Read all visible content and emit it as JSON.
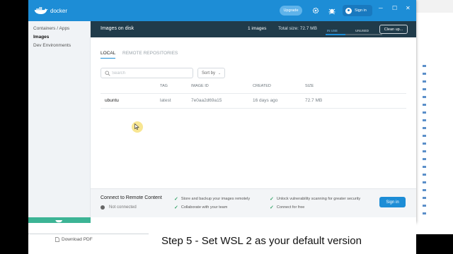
{
  "app": {
    "name": "docker",
    "upgrade_label": "Upgrade",
    "signin_label": "Sign in",
    "accent": "#1d8dd6"
  },
  "sidebar": {
    "items": [
      {
        "label": "Containers / Apps",
        "active": false
      },
      {
        "label": "Images",
        "active": true
      },
      {
        "label": "Dev Environments",
        "active": false
      }
    ]
  },
  "header": {
    "title": "Images on disk",
    "count": "1 images",
    "total_size": "Total size: 72.7 MB",
    "in_use_label": "IN USE",
    "unused_label": "UNUSED",
    "in_use_fraction": 0.35,
    "cleanup_label": "Clean up..."
  },
  "tabs": [
    {
      "label": "LOCAL",
      "active": true
    },
    {
      "label": "REMOTE REPOSITORIES",
      "active": false
    }
  ],
  "search": {
    "placeholder": "Search",
    "value": ""
  },
  "sort": {
    "label": "Sort by"
  },
  "table": {
    "columns": [
      "TAG",
      "IMAGE ID",
      "CREATED",
      "SIZE"
    ],
    "rows": [
      {
        "name": "ubuntu",
        "tag": "latest",
        "image_id": "7e0aa2d69a15",
        "created": "16 days ago",
        "size": "72.7 MB"
      }
    ]
  },
  "remote": {
    "title": "Connect to Remote Content",
    "status": "Not connected",
    "features": [
      "Store and backup your images remotely",
      "Collaborate with your team",
      "Unlock vulnerability scanning for greater security",
      "Connect for free"
    ],
    "signin_label": "Sign in"
  },
  "bottom": {
    "download_label": "Download PDF",
    "caption": "Step 5 - Set WSL 2 as your default version"
  }
}
